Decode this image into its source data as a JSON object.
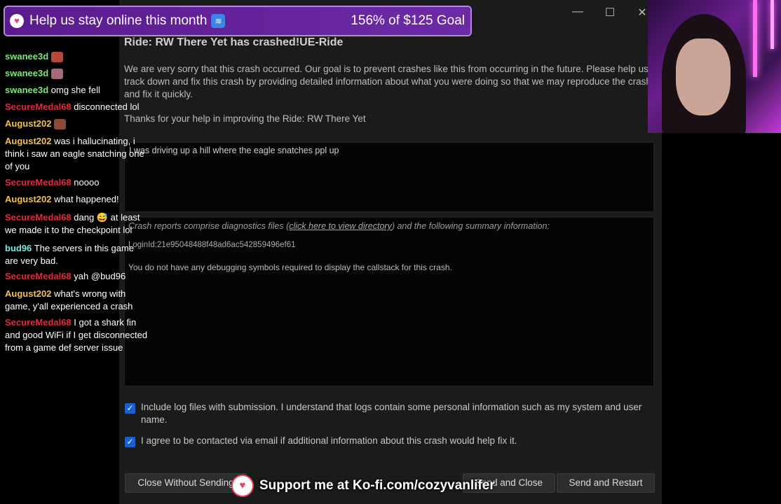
{
  "window": {
    "title": "Ride: RW There Yet has crashed!UE-Ride",
    "controls": {
      "minimize": "—",
      "maximize": "☐",
      "close": "✕"
    },
    "intro": "We are very sorry that this crash occurred. Our goal is to prevent crashes like this from occurring in the future. Please help us track down and fix this crash by providing detailed information about what you were doing so that we may reproduce the crash and fix it quickly.",
    "thanks": "Thanks for your help in improving the Ride: RW There Yet",
    "user_input": "I was driving up a hill where the eagle snatches ppl up",
    "summary": {
      "line_prefix": "Crash reports comprise diagnostics files (",
      "link": "click here to view directory",
      "line_suffix": ") and the following summary information:",
      "login_id": "LoginId:21e95048488f48ad6ac542859496ef61",
      "no_symbols": "You do not have any debugging symbols required to display the callstack for this crash."
    },
    "include_logs": {
      "label": "Include log files with submission. I understand that logs contain some personal information such as my system and user name.",
      "checked": true
    },
    "agree_contact": {
      "label": "I agree to be contacted via email if additional information about this crash would help fix it.",
      "checked": true
    },
    "buttons": {
      "close_without_sending": "Close Without Sending",
      "send_and_close": "Send and Close",
      "send_and_restart": "Send and Restart"
    }
  },
  "goal_banner": {
    "text": "Help us stay online this month",
    "amount": "156% of $125 Goal",
    "progress_percent": 156
  },
  "chat": [
    {
      "user": "swanee3d",
      "color": "#7be87b",
      "text": "",
      "emote": "#b8463a"
    },
    {
      "user": "swanee3d",
      "color": "#7be87b",
      "text": "",
      "emote": "#a46a7a"
    },
    {
      "user": "swanee3d",
      "color": "#7be87b",
      "text": "omg she fell"
    },
    {
      "user": "SecureMedal68",
      "color": "#e3293b",
      "text": "disconnected lol"
    },
    {
      "user": "August202",
      "color": "#f0c24f",
      "text": "",
      "emote": "#8a4a3a"
    },
    {
      "user": "August202",
      "color": "#f0c24f",
      "text": "was i hallucinating, i think i saw an eagle snatching one of you"
    },
    {
      "user": "SecureMedal68",
      "color": "#e3293b",
      "text": "noooo"
    },
    {
      "user": "August202",
      "color": "#f0c24f",
      "text": "what happened!"
    },
    {
      "user": "SecureMedal68",
      "color": "#e3293b",
      "text": "dang 😅 at least we made it to the checkpoint lol"
    },
    {
      "user": "bud96",
      "color": "#7be8e0",
      "text": "The servers in this game are very bad."
    },
    {
      "user": "SecureMedal68",
      "color": "#e3293b",
      "text": "yah @bud96"
    },
    {
      "user": "August202",
      "color": "#f0c24f",
      "text": "what's wrong with game, y'all experienced a crash"
    },
    {
      "user": "SecureMedal68",
      "color": "#e3293b",
      "text": "I got a shark fin and good WiFi if I get disconnected from a game def server issue"
    }
  ],
  "kofi": {
    "text": "Support me at Ko-fi.com/cozyvanlifer"
  }
}
